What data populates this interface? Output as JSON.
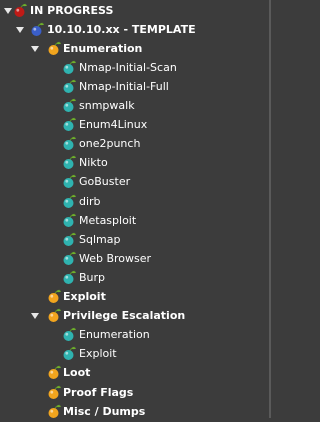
{
  "colors": {
    "background": "#3c3c3c",
    "text": "#ffffff",
    "red_node": "#c01a16",
    "blue_node": "#3a5ec8",
    "orange_node": "#f2a51e",
    "teal_node": "#2fb3b0"
  },
  "tree": [
    {
      "label": "IN PROGRESS",
      "level": 0,
      "icon": "red-cherry-icon",
      "expanded": true,
      "bold": true
    },
    {
      "label": "10.10.10.xx - TEMPLATE",
      "level": 1,
      "icon": "blue-cherry-icon",
      "expanded": true,
      "bold": true
    },
    {
      "label": "Enumeration",
      "level": 2,
      "icon": "orange-cherry-icon",
      "expanded": true,
      "bold": true
    },
    {
      "label": "Nmap-Initial-Scan",
      "level": 3,
      "icon": "teal-cherry-icon",
      "expanded": false,
      "bold": false
    },
    {
      "label": "Nmap-Initial-Full",
      "level": 3,
      "icon": "teal-cherry-icon",
      "expanded": false,
      "bold": false
    },
    {
      "label": "snmpwalk",
      "level": 3,
      "icon": "teal-cherry-icon",
      "expanded": false,
      "bold": false
    },
    {
      "label": "Enum4Linux",
      "level": 3,
      "icon": "teal-cherry-icon",
      "expanded": false,
      "bold": false
    },
    {
      "label": "one2punch",
      "level": 3,
      "icon": "teal-cherry-icon",
      "expanded": false,
      "bold": false
    },
    {
      "label": "Nikto",
      "level": 3,
      "icon": "teal-cherry-icon",
      "expanded": false,
      "bold": false
    },
    {
      "label": "GoBuster",
      "level": 3,
      "icon": "teal-cherry-icon",
      "expanded": false,
      "bold": false
    },
    {
      "label": "dirb",
      "level": 3,
      "icon": "teal-cherry-icon",
      "expanded": false,
      "bold": false
    },
    {
      "label": "Metasploit",
      "level": 3,
      "icon": "teal-cherry-icon",
      "expanded": false,
      "bold": false
    },
    {
      "label": "Sqlmap",
      "level": 3,
      "icon": "teal-cherry-icon",
      "expanded": false,
      "bold": false
    },
    {
      "label": "Web Browser",
      "level": 3,
      "icon": "teal-cherry-icon",
      "expanded": false,
      "bold": false
    },
    {
      "label": "Burp",
      "level": 3,
      "icon": "teal-cherry-icon",
      "expanded": false,
      "bold": false
    },
    {
      "label": "Exploit",
      "level": 2,
      "icon": "orange-cherry-icon",
      "expanded": false,
      "bold": true
    },
    {
      "label": "Privilege Escalation",
      "level": 2,
      "icon": "orange-cherry-icon",
      "expanded": true,
      "bold": true
    },
    {
      "label": "Enumeration",
      "level": 3,
      "icon": "teal-cherry-icon",
      "expanded": false,
      "bold": false
    },
    {
      "label": "Exploit",
      "level": 3,
      "icon": "teal-cherry-icon",
      "expanded": false,
      "bold": false
    },
    {
      "label": "Loot",
      "level": 2,
      "icon": "orange-cherry-icon",
      "expanded": false,
      "bold": true
    },
    {
      "label": "Proof Flags",
      "level": 2,
      "icon": "orange-cherry-icon",
      "expanded": false,
      "bold": true
    },
    {
      "label": "Misc / Dumps",
      "level": 2,
      "icon": "orange-cherry-icon",
      "expanded": false,
      "bold": true
    }
  ]
}
